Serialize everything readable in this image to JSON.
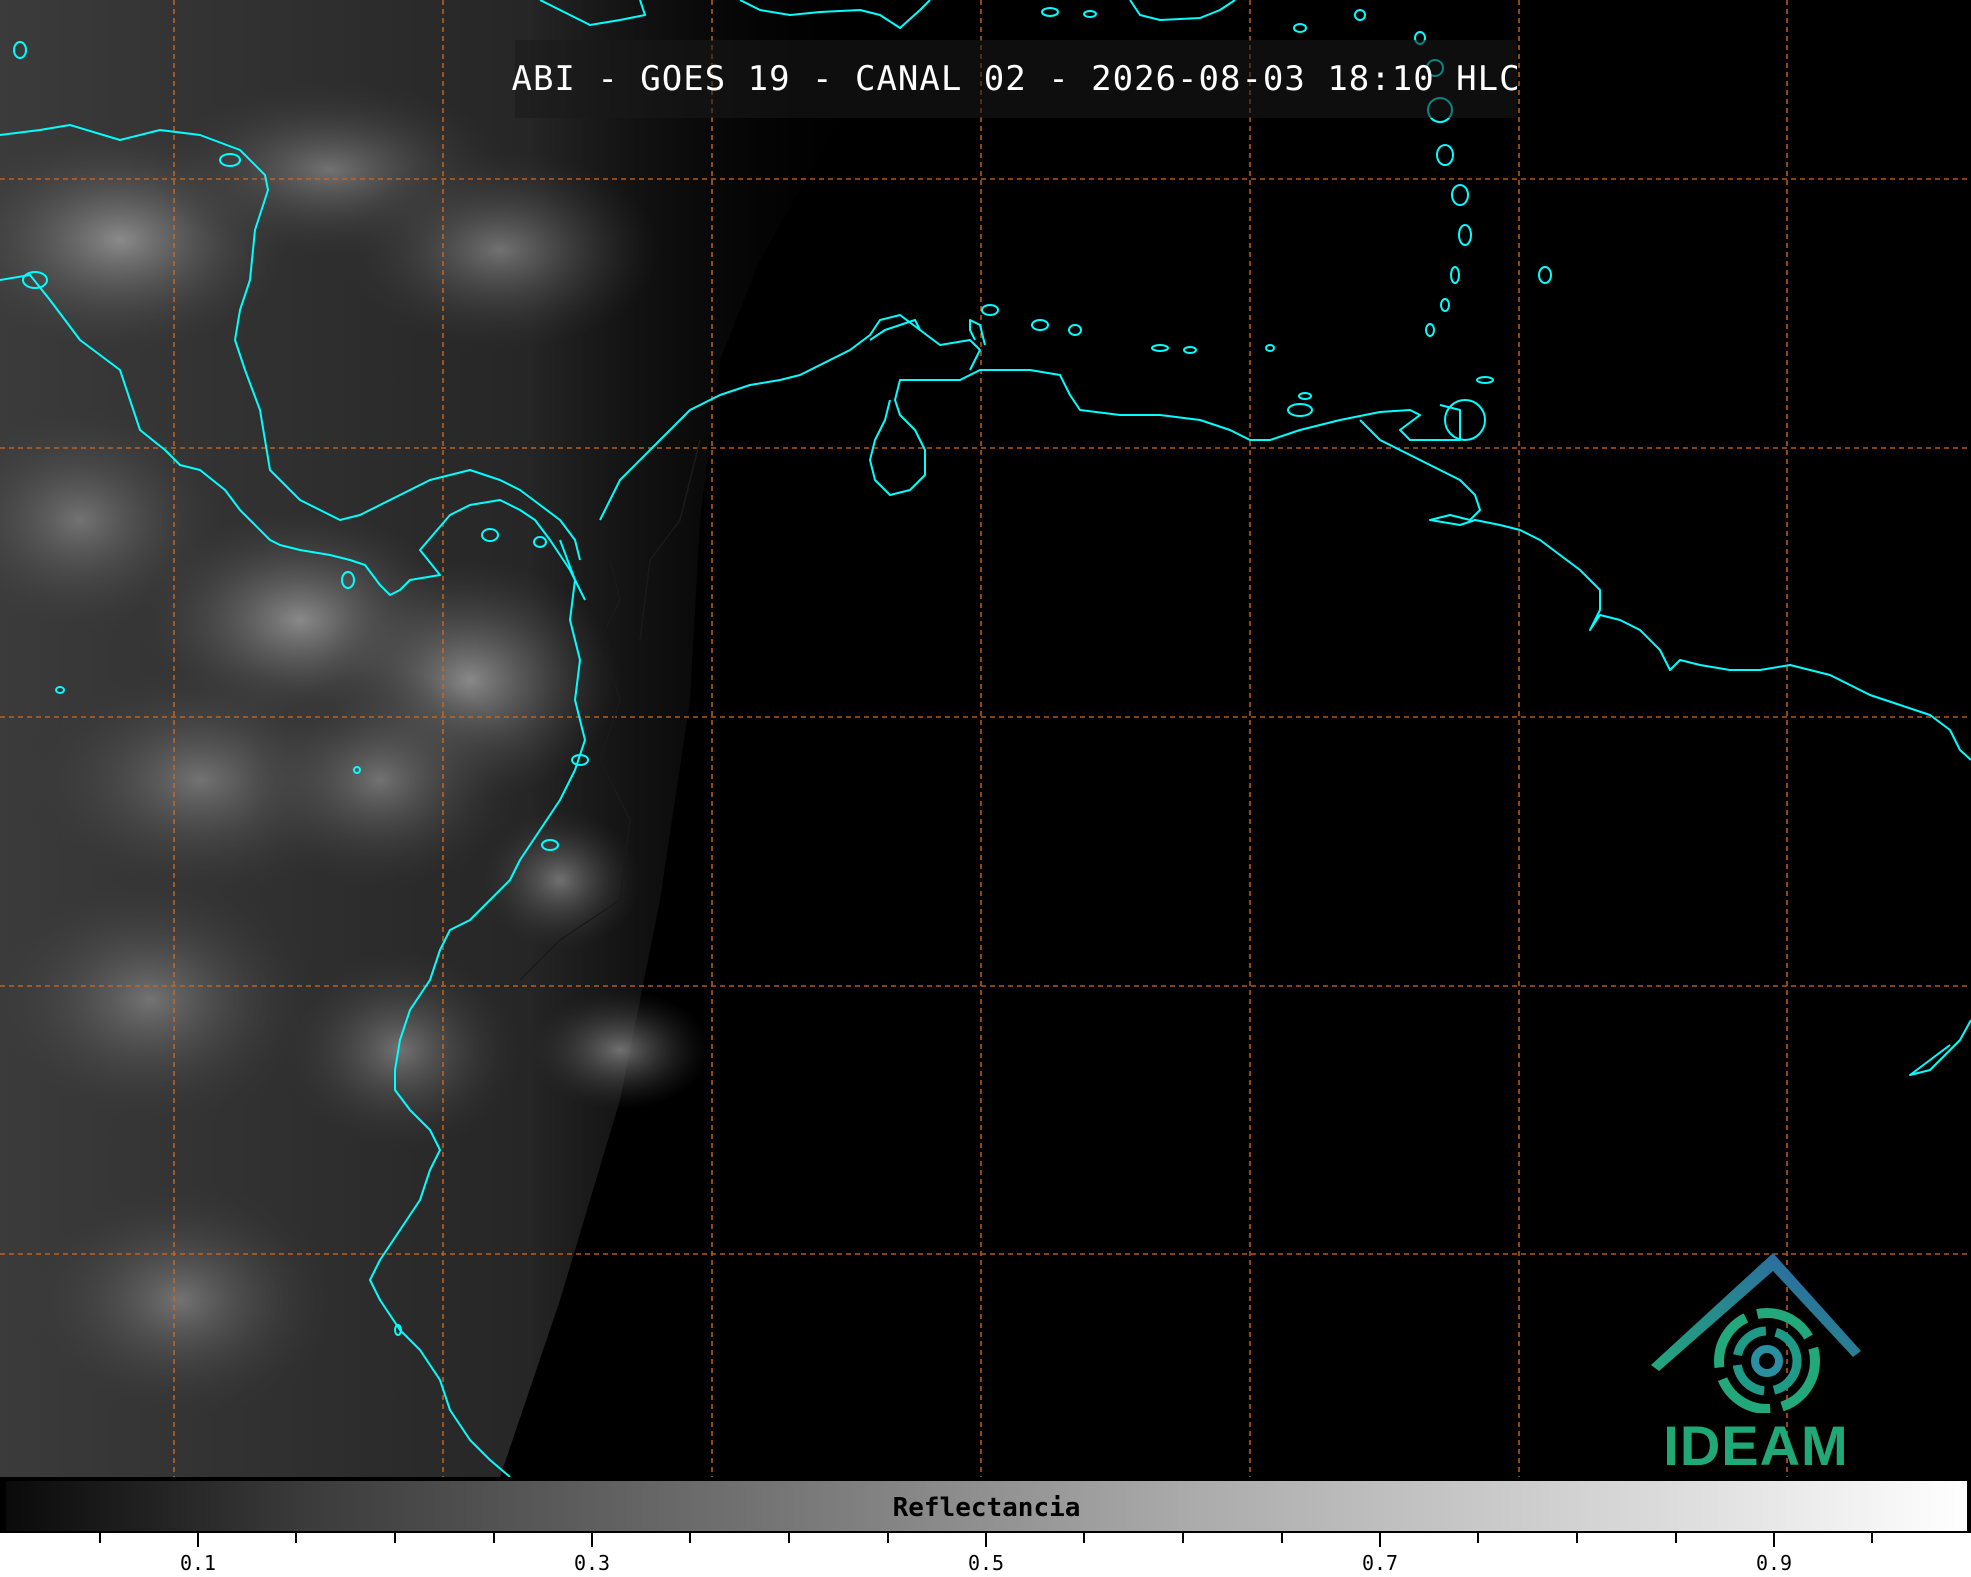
{
  "title": "ABI - GOES 19 - CANAL 02 - 2026-08-03 18:10 HLC",
  "logo": {
    "text": "IDEAM",
    "colors": {
      "arc": "#2e6fb0",
      "swirl": "#22a87a",
      "text": "#21a877"
    }
  },
  "colorbar": {
    "label": "Reflectancia",
    "ticks": [
      "0.1",
      "0.3",
      "0.5",
      "0.7",
      "0.9"
    ]
  },
  "colors": {
    "coastline": "#00ffff",
    "grid": "#d2691e",
    "background": "#000000"
  }
}
